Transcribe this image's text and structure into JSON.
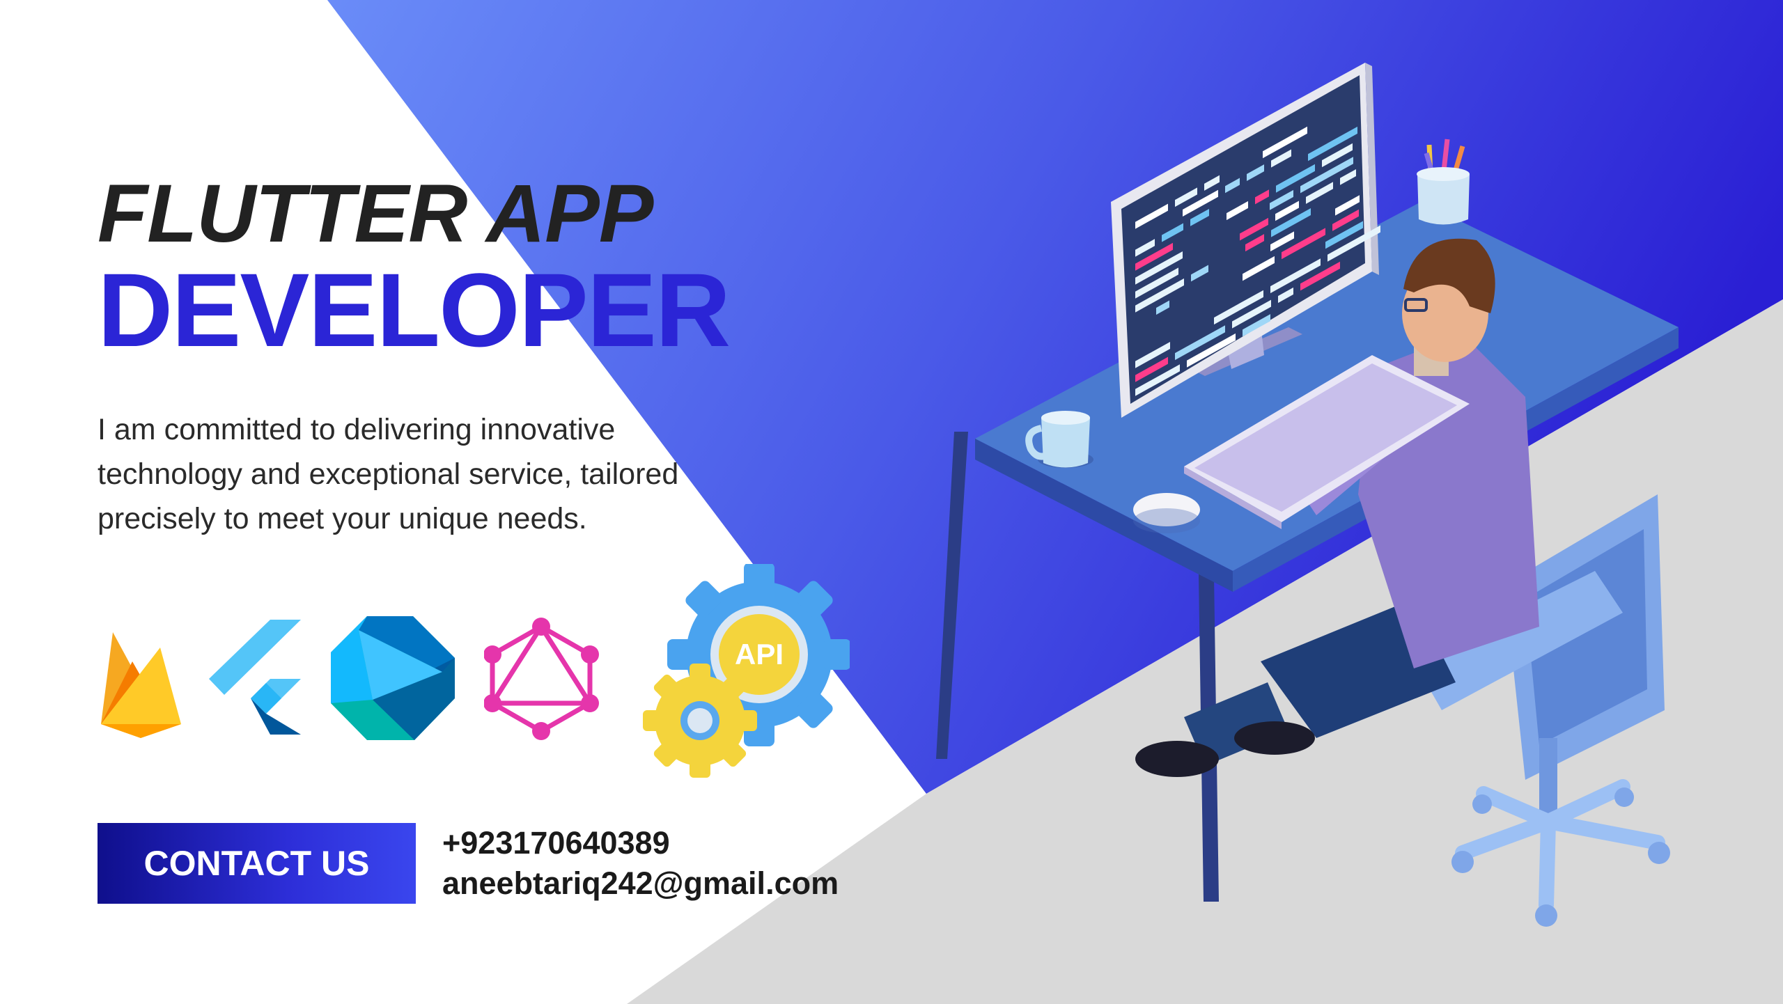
{
  "header": {
    "line1": "FLUTTER APP",
    "line2": "DEVELOPER"
  },
  "tagline": {
    "line1": "I am committed to delivering innovative",
    "line2": "technology and exceptional service, tailored",
    "line3": "precisely to meet your unique needs."
  },
  "tech_icons": [
    {
      "name": "firebase-icon"
    },
    {
      "name": "flutter-icon"
    },
    {
      "name": "dart-icon"
    },
    {
      "name": "graphql-icon"
    },
    {
      "name": "api-gears-icon",
      "label": "API"
    }
  ],
  "cta": {
    "label": "CONTACT US"
  },
  "contact": {
    "phone": "+923170640389",
    "email": "aneebtariq242@gmail.com"
  },
  "colors": {
    "accent": "#2b25d6",
    "gradient_start": "#6a8cf8",
    "gradient_end": "#2a1fd4",
    "floor_gray": "#d9d9d9",
    "title_dark": "#222222"
  }
}
